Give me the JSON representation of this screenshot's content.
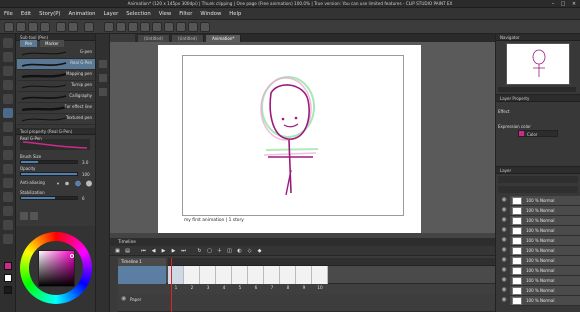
{
  "window": {
    "title": "Animation* (120 x 145px 300dpi) | Thunk clipping | One page (Free animation) 100.0% | True version: You can use limited features - CLIP STUDIO PAINT EX"
  },
  "menu": [
    "File",
    "Edit",
    "Story(P)",
    "Animation",
    "Layer",
    "Selection",
    "View",
    "Filter",
    "Window",
    "Help"
  ],
  "tabs": [
    {
      "label": "(Untitled)"
    },
    {
      "label": "(Untitled)"
    },
    {
      "label": "Animation*"
    }
  ],
  "sub_tool": {
    "title": "Sub tool (Pen)",
    "tabs": [
      "Pen",
      "Marker"
    ],
    "brushes": [
      {
        "name": "G-pen"
      },
      {
        "name": "Real G-Pen"
      },
      {
        "name": "Mapping pen"
      },
      {
        "name": "Turnip pen"
      },
      {
        "name": "Calligraphy"
      },
      {
        "name": "For effect line"
      },
      {
        "name": "Textured pen"
      }
    ]
  },
  "tool_property": {
    "title": "Tool property (Real G-Pen)",
    "brush_name": "Real G-Pen",
    "brush_size_label": "Brush Size",
    "brush_size_value": "3.0",
    "opacity_label": "Opacity",
    "opacity_value": "100",
    "anti_alias_label": "Anti-aliasing",
    "stabilization_label": "Stabilization",
    "stabilization_value": "6",
    "brush_size_fraction": 0.3,
    "opacity_fraction": 1.0,
    "stabilization_fraction": 0.6
  },
  "colors": {
    "main": "#cc2b8c",
    "sub": "#ffffff",
    "stroke": "#9b1b7d",
    "onion_green": "#8fe3a0",
    "onion_pink": "#f0a6d6"
  },
  "canvas": {
    "caption": "my first animation | 1 story"
  },
  "timeline": {
    "title": "Timeline",
    "track_name": "Timeline 1",
    "layer_name": "Paper",
    "frame_numbers": [
      "1",
      "2",
      "3",
      "4",
      "5",
      "6",
      "7",
      "8",
      "9",
      "10"
    ]
  },
  "navigator": {
    "title": "Navigator"
  },
  "layer_property": {
    "title": "Layer Property",
    "effect_label": "Effect",
    "expression_color_label": "Expression color",
    "expression_color_value": "Color"
  },
  "layers": {
    "title": "Layer",
    "items": [
      {
        "name": "100 % Normal"
      },
      {
        "name": "100 % Normal"
      },
      {
        "name": "100 % Normal"
      },
      {
        "name": "100 % Normal"
      },
      {
        "name": "100 % Normal"
      },
      {
        "name": "100 % Normal"
      },
      {
        "name": "100 % Normal"
      },
      {
        "name": "100 % Normal"
      },
      {
        "name": "100 % Normal"
      },
      {
        "name": "100 % Normal"
      },
      {
        "name": "100 % Normal"
      }
    ]
  }
}
